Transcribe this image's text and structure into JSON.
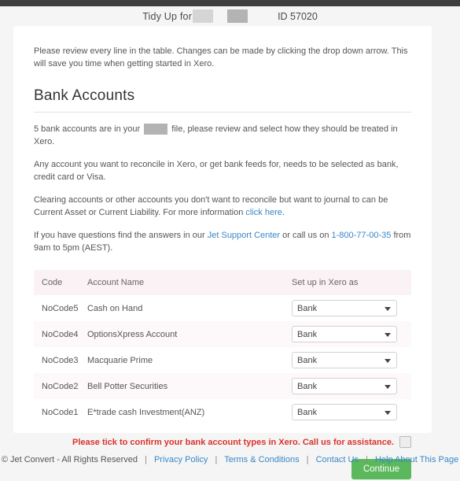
{
  "window": {
    "topbar_color": "#3f3f3f",
    "page_background": "#f5f5f5"
  },
  "header": {
    "title": "Tidy Up for",
    "redacted_name": "",
    "redacted_extra": "",
    "id_label": "ID 57020"
  },
  "intro": {
    "text": "Please review every line in the table. Changes can be made by clicking the drop down arrow. This will save you time when getting started in Xero."
  },
  "section": {
    "title": "Bank Accounts"
  },
  "body": {
    "para1_before": "5 bank accounts are in your",
    "para1_after": "file, please review and select how they should be treated in Xero.",
    "para2": "Any account you want to reconcile in Xero, or get bank feeds for, needs to be selected as bank, credit card or Visa.",
    "para3_before": "Clearing accounts or other accounts you don't want to reconcile but want to journal to can be Current Asset or Current Liability. For more information",
    "para3_link": "click here",
    "para3_after": ".",
    "para4_before": "If you have questions find the answers in our",
    "para4_link1": "Jet Support Center",
    "para4_mid": "or call us on",
    "para4_link2": "1-800-77-00-35",
    "para4_after": "from 9am to 5pm (AEST)."
  },
  "table": {
    "headers": {
      "code": "Code",
      "name": "Account Name",
      "setup": "Set up in Xero as"
    },
    "rows": [
      {
        "code": "NoCode5",
        "name": "Cash on Hand",
        "setup": "Bank"
      },
      {
        "code": "NoCode4",
        "name": "OptionsXpress Account",
        "setup": "Bank"
      },
      {
        "code": "NoCode3",
        "name": "Macquarie Prime",
        "setup": "Bank"
      },
      {
        "code": "NoCode2",
        "name": "Bell Potter Securities",
        "setup": "Bank"
      },
      {
        "code": "NoCode1",
        "name": "E*trade cash Investment(ANZ)",
        "setup": "Bank"
      }
    ]
  },
  "confirm": {
    "text": "Please tick to confirm your bank account types in Xero. Call us for assistance.",
    "color": "#d9332b",
    "checked": false
  },
  "actions": {
    "continue_label": "Continue",
    "continue_color": "#5cb85c"
  },
  "footer": {
    "copyright": "© Jet Convert - All Rights Reserved",
    "links": [
      "Privacy Policy",
      "Terms & Conditions",
      "Contact Us",
      "Help About This Page"
    ],
    "separator": "|"
  }
}
